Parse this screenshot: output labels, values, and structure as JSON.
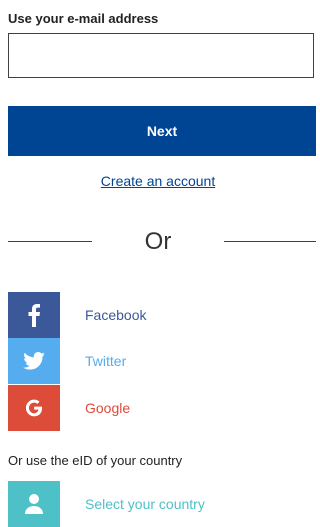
{
  "email": {
    "label": "Use your e-mail address",
    "value": "",
    "placeholder": ""
  },
  "next_button": {
    "label": "Next"
  },
  "create_account_link": {
    "label": "Create an account"
  },
  "separator": {
    "label": "Or"
  },
  "social_logins": [
    {
      "label": "Facebook",
      "icon": "facebook-icon",
      "icon_bg": "#3b5998",
      "text_color": "#3b5998"
    },
    {
      "label": "Twitter",
      "icon": "twitter-icon",
      "icon_bg": "#55acee",
      "text_color": "#55acee"
    },
    {
      "label": "Google",
      "icon": "google-icon",
      "icon_bg": "#dd4b39",
      "text_color": "#dd4b39"
    }
  ],
  "eid": {
    "label": "Or use the eID of your country",
    "select_label": "Select your country",
    "icon": "user-icon",
    "icon_bg": "#4ec0c8",
    "text_color": "#4ec0c8"
  },
  "colors": {
    "primary": "#004494",
    "border": "#404040"
  }
}
